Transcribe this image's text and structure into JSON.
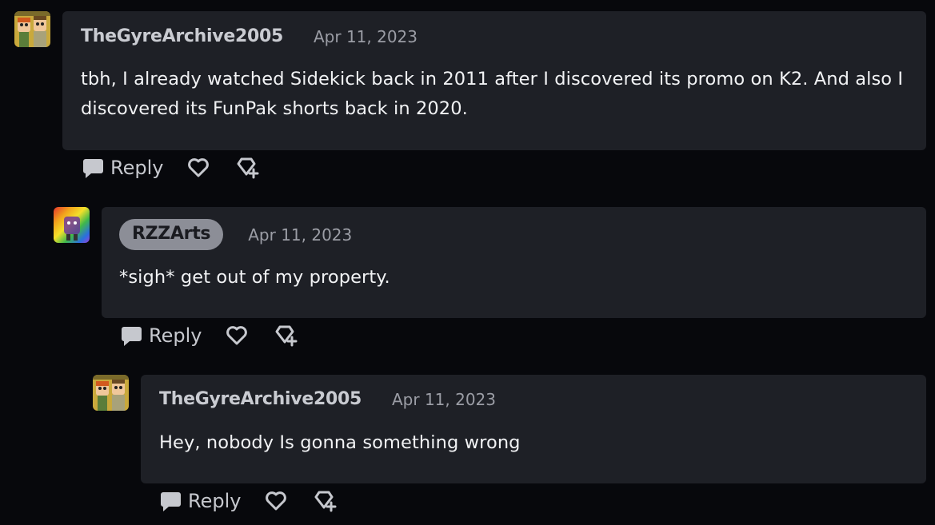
{
  "comments": [
    {
      "username": "TheGyreArchive2005",
      "date": "Apr 11, 2023",
      "text": "tbh, I already watched Sidekick back in 2011 after I discovered its promo on K2. And also I discovered its FunPak shorts back in 2020.",
      "reply_label": "Reply"
    },
    {
      "username": "RZZArts",
      "date": "Apr 11, 2023",
      "text": "*sigh* get out of my property.",
      "reply_label": "Reply"
    },
    {
      "username": "TheGyreArchive2005",
      "date": "Apr 11, 2023",
      "text": "Hey, nobody Is gonna something wrong",
      "reply_label": "Reply"
    }
  ],
  "icons": {
    "reply": "speech-bubble-icon",
    "like": "heart-icon",
    "award": "gift-award-icon"
  },
  "colors": {
    "background": "#07080c",
    "bubble": "#1e2026",
    "username": "#c9cbd1",
    "date": "#9b9da5",
    "pill": "#8c8e97"
  }
}
